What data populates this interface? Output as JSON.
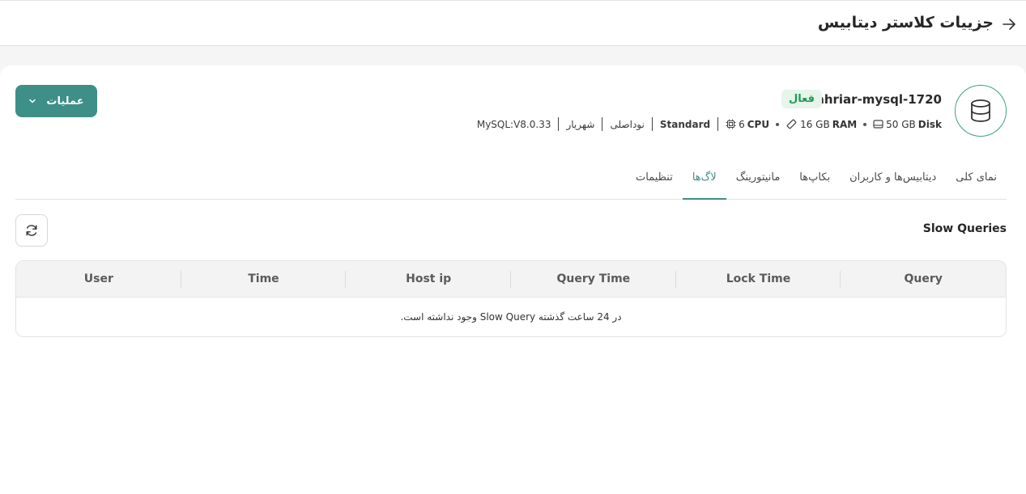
{
  "header": {
    "title": "جزییات کلاستر دیتابیس",
    "back_icon": "arrow-right-icon"
  },
  "cluster": {
    "name": "shahriar-mysql-1720",
    "status": "فعال",
    "icon": "database-icon",
    "disk_value": "50 GB",
    "disk_unit": "Disk",
    "ram_value": "16 GB",
    "ram_unit": "RAM",
    "cpu_value": "6",
    "cpu_unit": "CPU",
    "plan": "Standard",
    "node_type": "نوداصلی",
    "location": "شهریار",
    "version": "MySQL:V8.0.33"
  },
  "actions": {
    "operations_label": "عملیات"
  },
  "tabs": [
    {
      "label": "نمای کلی",
      "active": false
    },
    {
      "label": "دیتابیس‌ها و کاربران",
      "active": false
    },
    {
      "label": "بکاپ‌ها",
      "active": false
    },
    {
      "label": "مانیتورینگ",
      "active": false
    },
    {
      "label": "لاگ‌ها",
      "active": true
    },
    {
      "label": "تنظیمات",
      "active": false
    }
  ],
  "slow_queries": {
    "title": "Slow Queries",
    "columns": [
      "Query",
      "Lock Time",
      "Query Time",
      "Host ip",
      "Time",
      "User"
    ],
    "empty_message": "در 24 ساعت گذشته Slow Query وجود نداشته است."
  },
  "colors": {
    "accent": "#3d8f87",
    "status_bg": "#e6f4ea",
    "status_text": "#1f9b50"
  }
}
